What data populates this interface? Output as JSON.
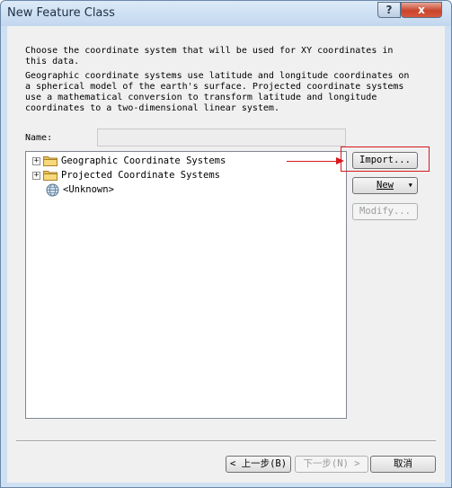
{
  "window": {
    "title": "New Feature Class",
    "help_label": "?",
    "close_label": "x"
  },
  "description": {
    "para1": "Choose the coordinate system that will be used for XY coordinates in\nthis data.",
    "para2": "Geographic coordinate systems use latitude and longitude coordinates on\na spherical model of the earth's surface. Projected coordinate systems\nuse a mathematical conversion to transform latitude and longitude\ncoordinates to a two-dimensional linear system."
  },
  "name_field": {
    "label": "Name:",
    "value": ""
  },
  "tree": {
    "items": [
      {
        "label": "Geographic Coordinate Systems",
        "expander": "+",
        "icon": "folder-icon"
      },
      {
        "label": "Projected Coordinate Systems",
        "expander": "+",
        "icon": "folder-icon"
      },
      {
        "label": "<Unknown>",
        "expander": "",
        "icon": "globe-icon"
      }
    ]
  },
  "buttons": {
    "import": "Import...",
    "new": "New",
    "new_dropdown": "▾",
    "modify": "Modify...",
    "back": "< 上一步(B)",
    "next": "下一步(N) >",
    "cancel": "取消"
  },
  "colors": {
    "highlight": "#d8171c"
  }
}
